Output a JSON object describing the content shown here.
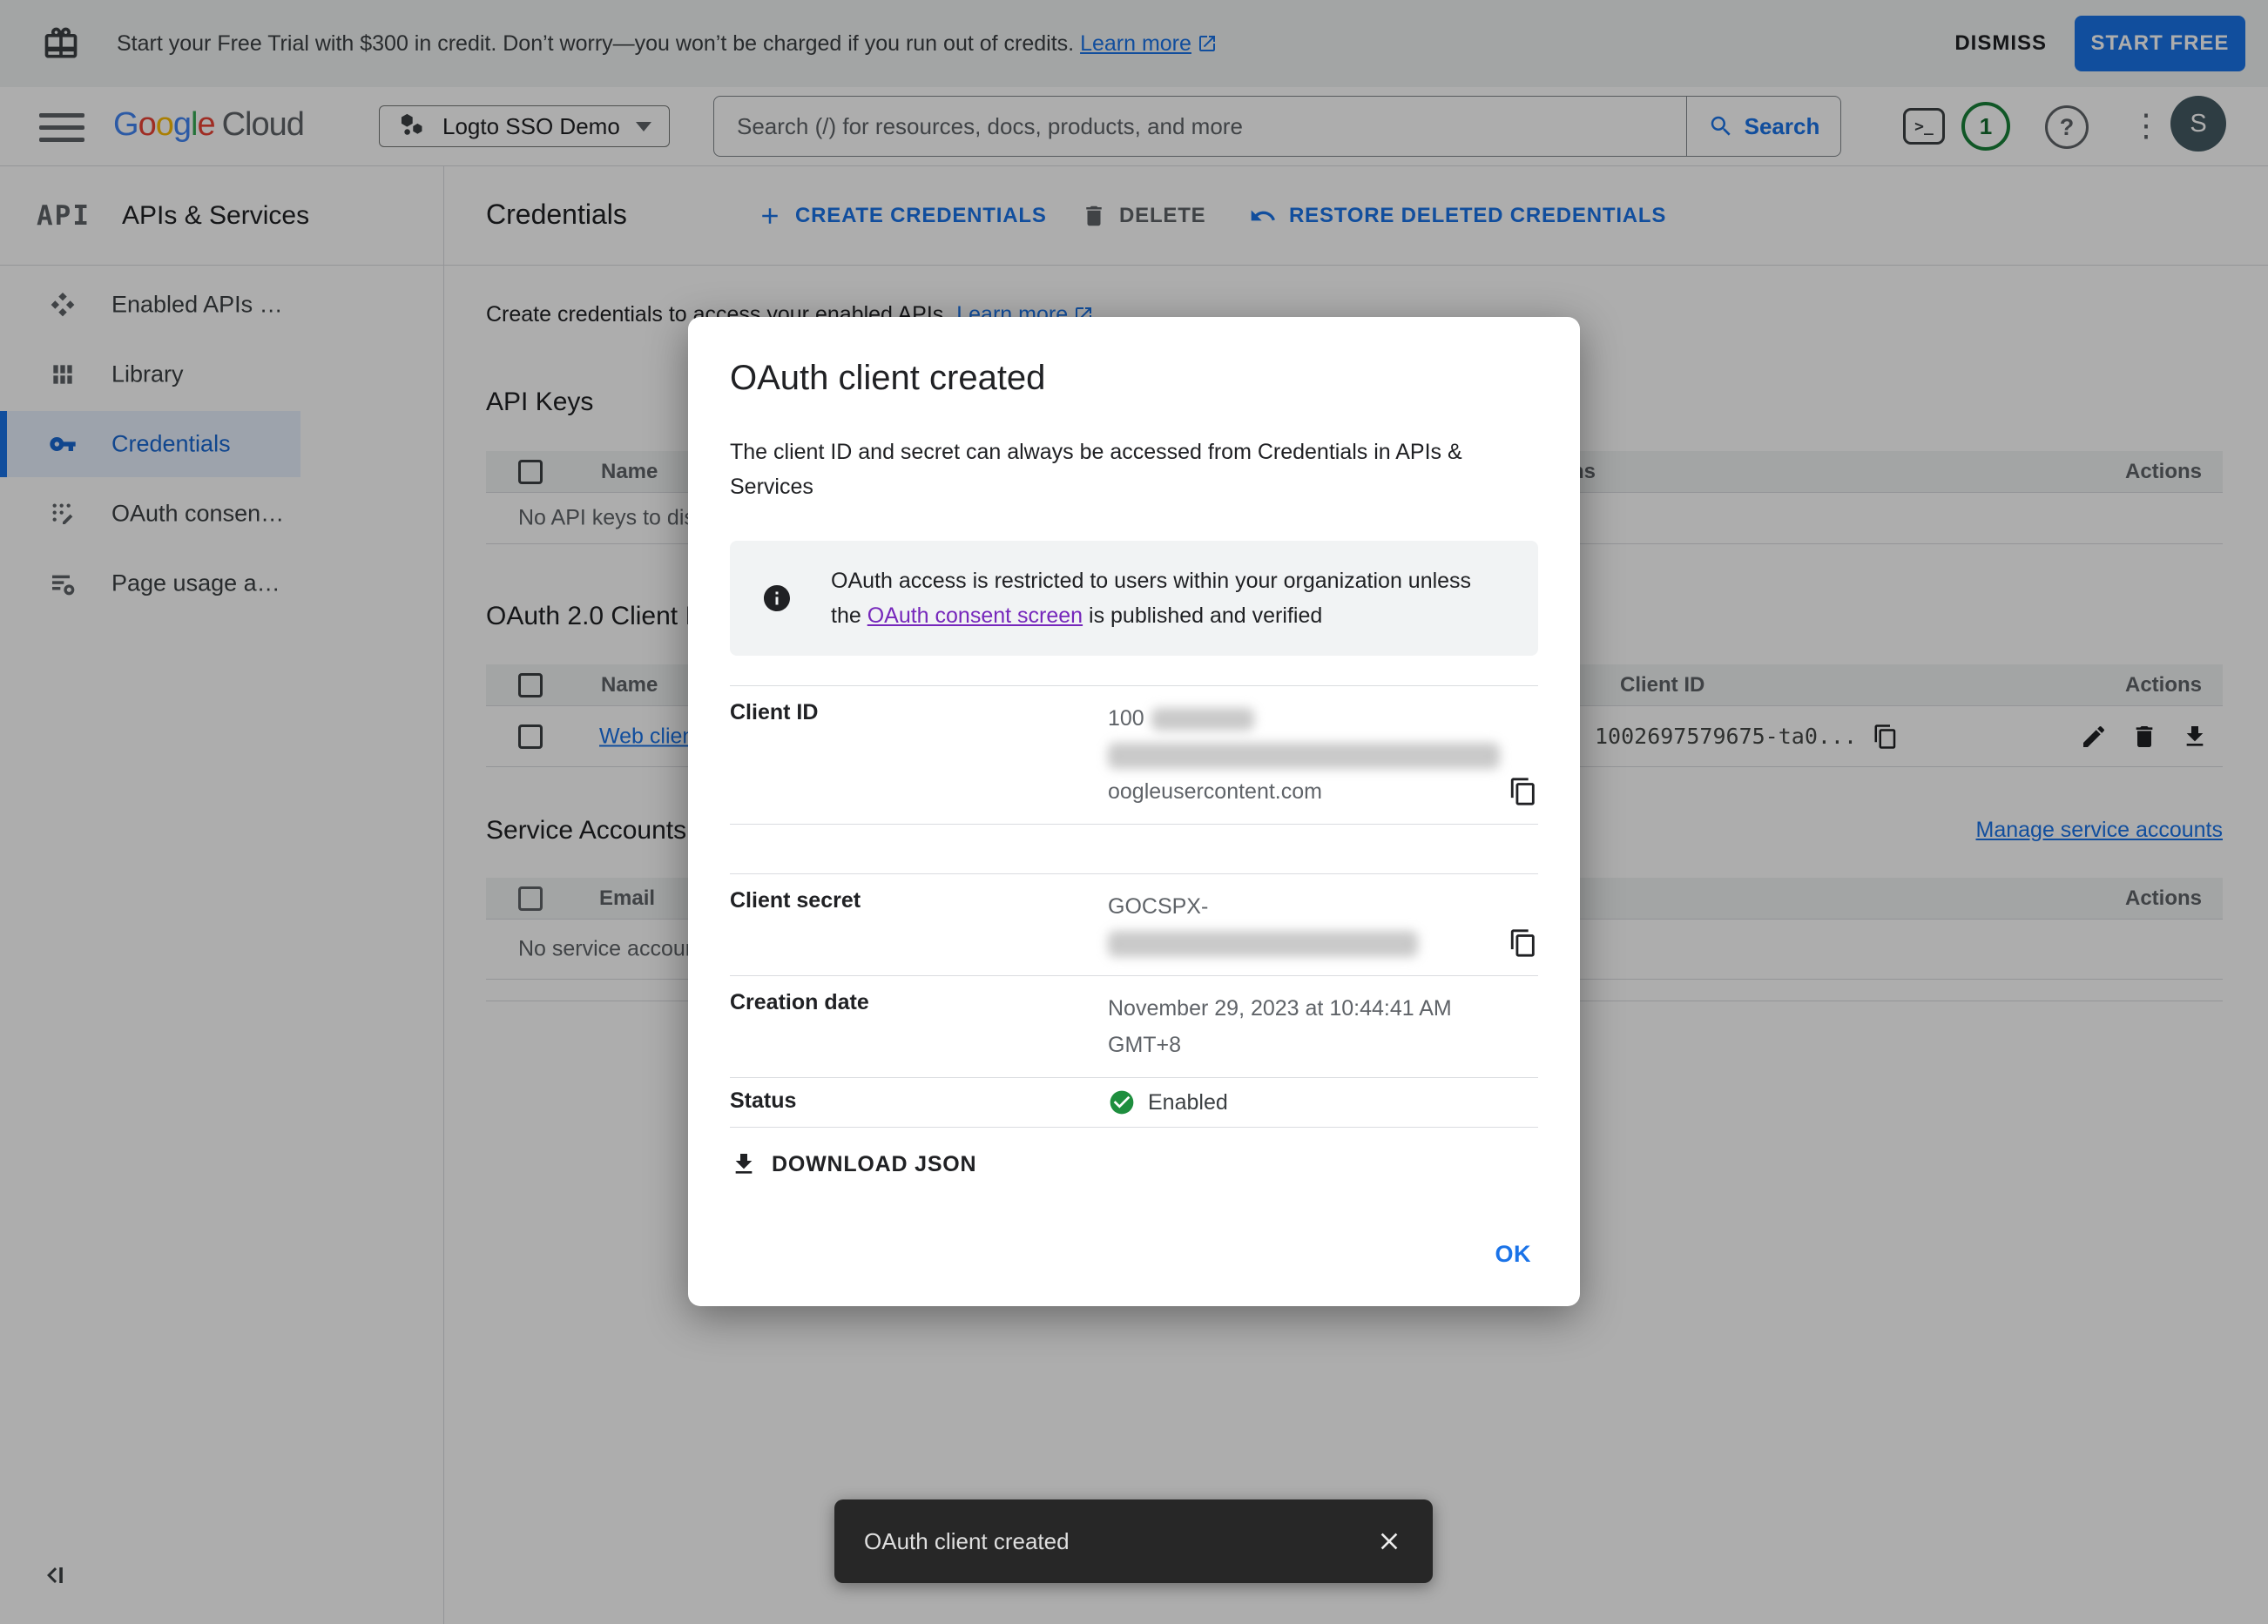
{
  "banner": {
    "message": "Start your Free Trial with $300 in credit. Don’t worry—you won’t be charged if you run out of credits.",
    "learn_more": "Learn more",
    "dismiss": "DISMISS",
    "start_free": "START FREE"
  },
  "header": {
    "logo_google": "Google",
    "logo_cloud": "Cloud",
    "project_selector": "Logto SSO Demo",
    "search_placeholder": "Search (/) for resources, docs, products, and more",
    "search_button": "Search",
    "terminal_glyph": ">_",
    "notification_count": "1",
    "help_glyph": "?",
    "more_glyph": "⋮",
    "avatar_initial": "S"
  },
  "sidebar": {
    "logo": "API",
    "title": "APIs & Services",
    "items": [
      {
        "label": "Enabled APIs …"
      },
      {
        "label": "Library"
      },
      {
        "label": "Credentials"
      },
      {
        "label": "OAuth consen…"
      },
      {
        "label": "Page usage a…"
      }
    ]
  },
  "page": {
    "title": "Credentials",
    "toolbar": {
      "create": "CREATE CREDENTIALS",
      "delete": "DELETE",
      "restore": "RESTORE DELETED CREDENTIALS"
    },
    "description": "Create credentials to access your enabled APIs.",
    "learn_more": "Learn more",
    "api_keys": {
      "heading": "API Keys",
      "col_name": "Name",
      "col_restrictions": "Restrictions",
      "col_actions": "Actions",
      "empty": "No API keys to display"
    },
    "oauth_clients": {
      "heading": "OAuth 2.0 Client IDs",
      "col_name": "Name",
      "col_client_id": "Client ID",
      "col_actions": "Actions",
      "row_name": "Web client 1",
      "row_client_id": "1002697579675-ta0..."
    },
    "service_accounts": {
      "heading": "Service Accounts",
      "manage_link": "Manage service accounts",
      "col_email": "Email",
      "col_actions": "Actions",
      "empty": "No service accounts to display"
    }
  },
  "modal": {
    "title": "OAuth client created",
    "description": "The client ID and secret can always be accessed from Credentials in APIs & Services",
    "notice_before": "OAuth access is restricted to users within your organization unless the ",
    "notice_link": "OAuth consent screen",
    "notice_after": " is published and verified",
    "client_id_label": "Client ID",
    "client_id_prefix": "100",
    "client_id_suffix": "oogleusercontent.com",
    "client_secret_label": "Client secret",
    "client_secret_prefix": "GOCSPX-",
    "creation_date_label": "Creation date",
    "creation_date_value": "November 29, 2023 at 10:44:41 AM GMT+8",
    "status_label": "Status",
    "status_value": "Enabled",
    "download_json": "DOWNLOAD JSON",
    "ok": "OK"
  },
  "toast": {
    "message": "OAuth client created"
  },
  "colors": {
    "accent_blue": "#1a73e8",
    "link_purple": "#7627bb",
    "status_green": "#1e8e3e",
    "selected_nav_blue": "#1967d2",
    "scrim": "rgba(0,0,0,0.32)",
    "toast_bg": "#272727"
  }
}
